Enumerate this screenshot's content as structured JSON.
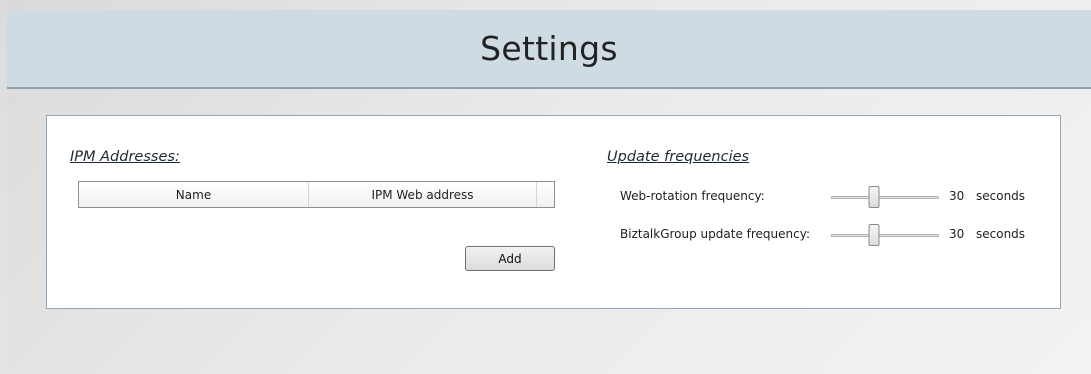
{
  "header": {
    "title": "Settings"
  },
  "ipm": {
    "title": "IPM Addresses:",
    "columns": [
      "Name",
      "IPM Web address"
    ],
    "add_label": "Add"
  },
  "updates": {
    "title": "Update frequencies",
    "rows": [
      {
        "label": "Web-rotation frequency:",
        "value": "30",
        "unit": "seconds",
        "slider_fraction": 0.4
      },
      {
        "label": "BiztalkGroup update frequency:",
        "value": "30",
        "unit": "seconds",
        "slider_fraction": 0.4
      }
    ]
  },
  "colors": {
    "header_bg": "#cfdbe3",
    "header_border": "#8aa1b1",
    "panel_border": "#8fa9bb"
  }
}
